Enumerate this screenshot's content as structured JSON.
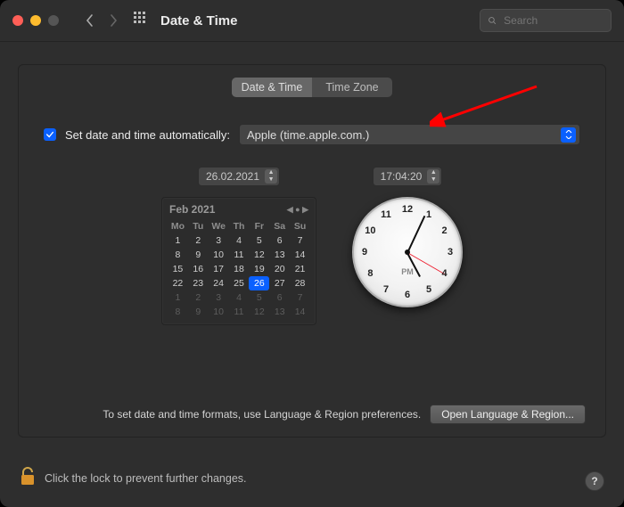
{
  "window": {
    "title": "Date & Time"
  },
  "search": {
    "placeholder": "Search"
  },
  "tabs": {
    "date_time": "Date & Time",
    "time_zone": "Time Zone"
  },
  "auto": {
    "label": "Set date and time automatically:",
    "server": "Apple (time.apple.com.)",
    "checked": true
  },
  "date_field": "26.02.2021",
  "time_field": "17:04:20",
  "calendar": {
    "month_label": "Feb 2021",
    "dow": [
      "Mo",
      "Tu",
      "We",
      "Th",
      "Fr",
      "Sa",
      "Su"
    ],
    "leading": [
      1,
      2,
      3,
      4,
      5,
      6,
      7
    ],
    "month": [
      8,
      9,
      10,
      11,
      12,
      13,
      14,
      15,
      16,
      17,
      18,
      19,
      20,
      21,
      22,
      23,
      24,
      25,
      26,
      27,
      28
    ],
    "trailing": [
      1,
      2,
      3,
      4,
      5,
      6,
      7,
      8,
      9,
      10,
      11,
      12,
      13,
      14
    ],
    "today": 26
  },
  "clock": {
    "numbers": [
      "12",
      "1",
      "2",
      "3",
      "4",
      "5",
      "6",
      "7",
      "8",
      "9",
      "10",
      "11"
    ],
    "ampm": "PM",
    "hour_angle": 62,
    "minute_angle": -65,
    "second_angle": 30
  },
  "footer": {
    "hint": "To set date and time formats, use Language & Region preferences.",
    "button": "Open Language & Region..."
  },
  "lock": {
    "text": "Click the lock to prevent further changes."
  },
  "help": "?"
}
